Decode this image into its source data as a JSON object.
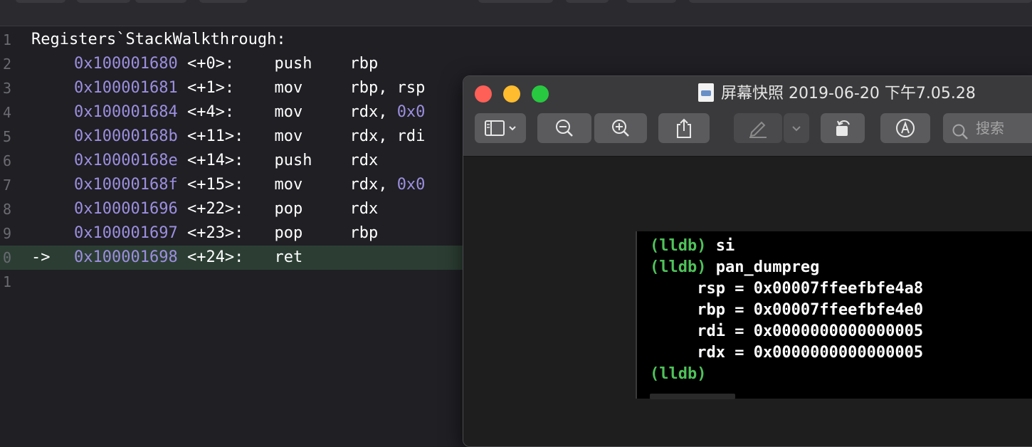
{
  "editor": {
    "lines": [
      {
        "no": "1",
        "text": "Registers`StackWalkthrough:"
      },
      {
        "no": "2",
        "addr": "0x100001680",
        "off": "<+0>:",
        "mnem": "push",
        "ops": "rbp"
      },
      {
        "no": "3",
        "addr": "0x100001681",
        "off": "<+1>:",
        "mnem": "mov",
        "ops": "rbp, rsp"
      },
      {
        "no": "4",
        "addr": "0x100001684",
        "off": "<+4>:",
        "mnem": "mov",
        "ops": "rdx, ",
        "imm": "0x0"
      },
      {
        "no": "5",
        "addr": "0x10000168b",
        "off": "<+11>:",
        "mnem": "mov",
        "ops": "rdx, rdi"
      },
      {
        "no": "6",
        "addr": "0x10000168e",
        "off": "<+14>:",
        "mnem": "push",
        "ops": "rdx"
      },
      {
        "no": "7",
        "addr": "0x10000168f",
        "off": "<+15>:",
        "mnem": "mov",
        "ops": "rdx, ",
        "imm": "0x0"
      },
      {
        "no": "8",
        "addr": "0x100001696",
        "off": "<+22>:",
        "mnem": "pop",
        "ops": "rdx"
      },
      {
        "no": "9",
        "addr": "0x100001697",
        "off": "<+23>:",
        "mnem": "pop",
        "ops": "rbp"
      },
      {
        "no": "0",
        "arrow": "->",
        "addr": "0x100001698",
        "off": "<+24>:",
        "mnem": "ret",
        "ops": ""
      },
      {
        "no": "1",
        "text": ""
      }
    ]
  },
  "preview": {
    "title": "屏幕快照 2019-06-20 下午7.05.28",
    "search_placeholder": "搜索",
    "icons": [
      "sidebar-icon",
      "chevron-down-icon",
      "zoom-out-icon",
      "zoom-in-icon",
      "share-icon",
      "highlight-icon",
      "rotate-icon",
      "markup-icon",
      "search-icon"
    ],
    "terminal": {
      "prompt": "(lldb)",
      "cmd1": " si",
      "cmd2": " pan_dumpreg",
      "regs": [
        "     rsp = 0x00007ffeefbfe4a8",
        "     rbp = 0x00007ffeefbfe4e0",
        "     rdi = 0x0000000000000005",
        "     rdx = 0x0000000000000005"
      ]
    }
  },
  "colors": {
    "prompt_green": "#4fc25a",
    "address_purple": "#9d8fe0",
    "current_line": "#2c3e34"
  }
}
